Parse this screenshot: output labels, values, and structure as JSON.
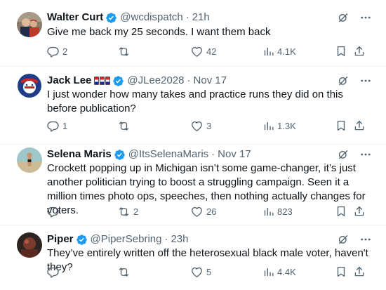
{
  "tweets": [
    {
      "name": "Walter Curt",
      "handle": "@wcdispatch",
      "time": "21h",
      "text": "Give me back my 25 seconds. I want them back",
      "replies": "2",
      "retweets": "",
      "likes": "42",
      "views": "4.1K"
    },
    {
      "name": "Jack Lee",
      "handle": "@JLee2028",
      "time": "Nov 17",
      "text": "I just wonder how many takes and practice runs they did on this before publication?",
      "replies": "1",
      "retweets": "",
      "likes": "3",
      "views": "1.3K"
    },
    {
      "name": "Selena Maris",
      "handle": "@ItsSelenaMaris",
      "time": "Nov 17",
      "text": "Crockett popping up in Michigan isn’t some game-changer, it’s just another politician trying to boost a struggling campaign. Seen it a million times photo ops, speeches, then nothing actually changes for voters.",
      "replies": "",
      "retweets": "2",
      "likes": "26",
      "views": "823"
    },
    {
      "name": "Piper",
      "handle": "@PiperSebring",
      "time": "23h",
      "text": "They’ve entirely written off the heterosexual black male voter, haven't they?",
      "replies": "",
      "retweets": "",
      "likes": "5",
      "views": "4.4K"
    }
  ],
  "colors": {
    "text": "#0f1419",
    "secondary": "#536471",
    "verified": "#1d9bf0",
    "separator": "#eff3f4"
  },
  "icons": [
    "verified-badge-icon",
    "grok-icon",
    "more-icon",
    "reply-icon",
    "retweet-icon",
    "like-icon",
    "views-icon",
    "bookmark-icon",
    "share-icon"
  ]
}
